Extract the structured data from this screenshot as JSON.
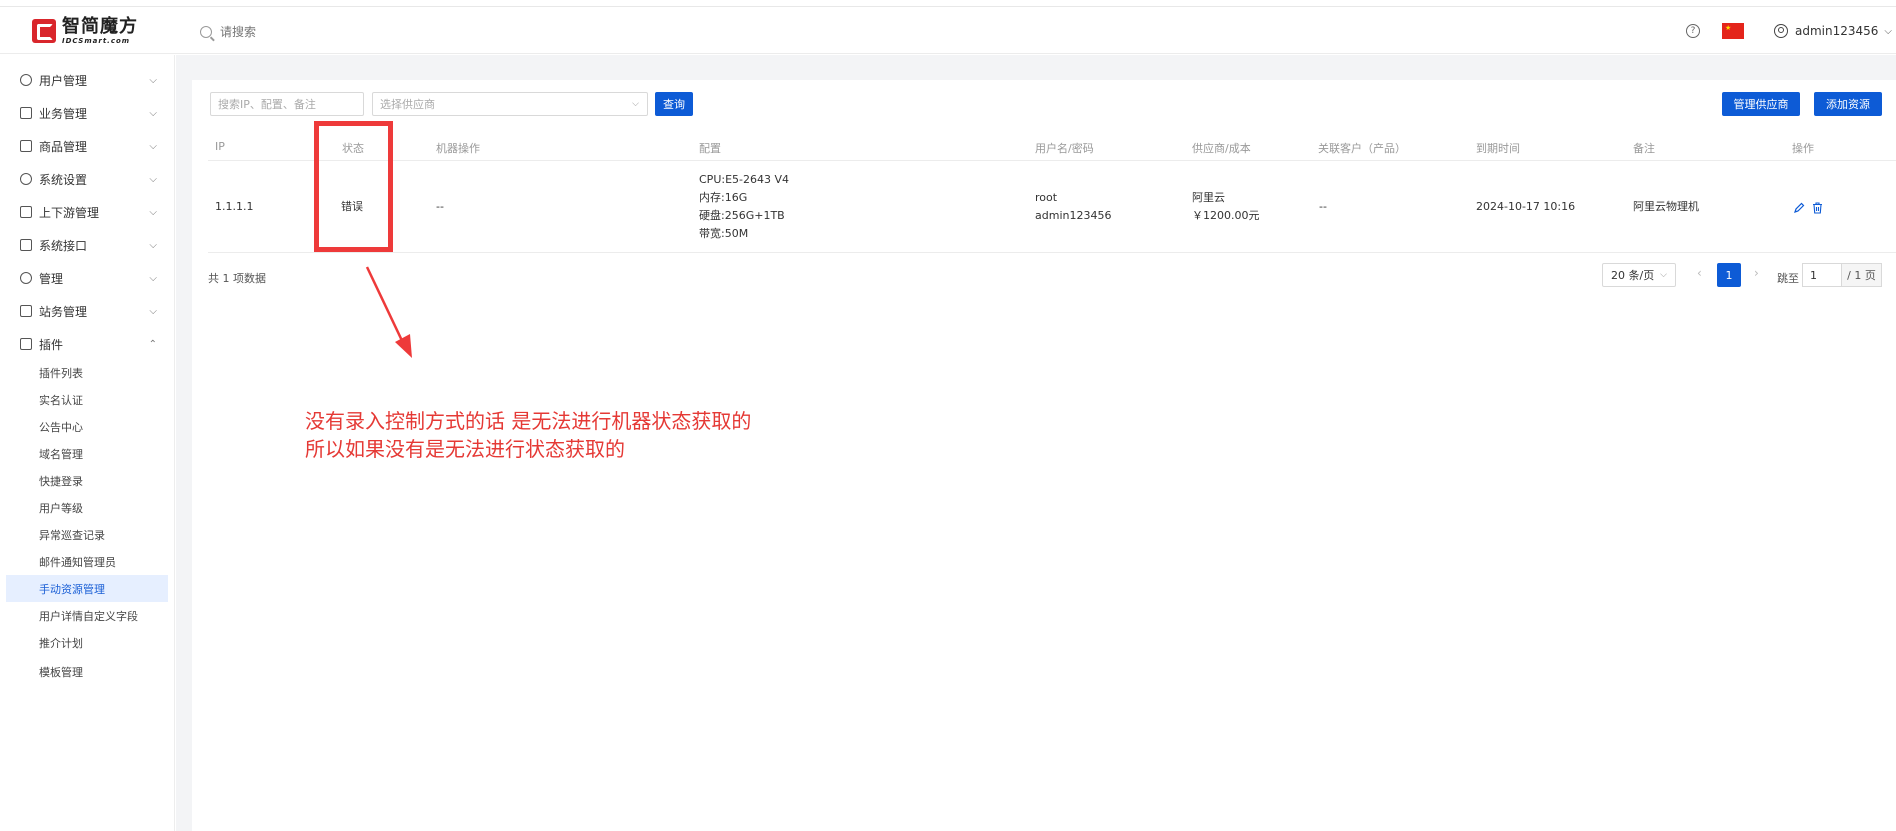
{
  "header": {
    "logo_cn": "智简魔方",
    "logo_en": "IDCSmart.com",
    "search_placeholder": "请搜索",
    "help": "?",
    "username": "admin123456"
  },
  "sidebar": {
    "items": [
      {
        "label": "用户管理"
      },
      {
        "label": "业务管理"
      },
      {
        "label": "商品管理"
      },
      {
        "label": "系统设置"
      },
      {
        "label": "上下游管理"
      },
      {
        "label": "系统接口"
      },
      {
        "label": "管理"
      },
      {
        "label": "站务管理"
      },
      {
        "label": "插件"
      }
    ],
    "sub_items": [
      {
        "label": "插件列表"
      },
      {
        "label": "实名认证"
      },
      {
        "label": "公告中心"
      },
      {
        "label": "域名管理"
      },
      {
        "label": "快捷登录"
      },
      {
        "label": "用户等级"
      },
      {
        "label": "异常巡查记录"
      },
      {
        "label": "邮件通知管理员"
      },
      {
        "label": "手动资源管理"
      },
      {
        "label": "用户详情自定义字段"
      },
      {
        "label": "推介计划"
      },
      {
        "label": "模板管理"
      }
    ]
  },
  "toolbar": {
    "search_placeholder": "搜索IP、配置、备注",
    "supplier_placeholder": "选择供应商",
    "query_label": "查询",
    "manage_supplier_label": "管理供应商",
    "add_resource_label": "添加资源"
  },
  "table": {
    "columns": [
      "IP",
      "状态",
      "机器操作",
      "配置",
      "用户名/密码",
      "供应商/成本",
      "关联客户（产品）",
      "到期时间",
      "备注",
      "操作"
    ],
    "rows": [
      {
        "ip": "1.1.1.1",
        "status": "错误",
        "machine_op": "--",
        "config": [
          "CPU:E5-2643 V4",
          "内存:16G",
          "硬盘:256G+1TB",
          "带宽:50M"
        ],
        "credentials": [
          "root",
          "admin123456"
        ],
        "supplier_cost": [
          "阿里云",
          "￥1200.00元"
        ],
        "client": "--",
        "expire": "2024-10-17 10:16",
        "note": "阿里云物理机"
      }
    ]
  },
  "pagination": {
    "total_text": "共 1 项数据",
    "page_size": "20 条/页",
    "current_page": "1",
    "jump_label": "跳至",
    "jump_value": "1",
    "total_pages": "/ 1 页"
  },
  "annotation": {
    "line1": "没有录入控制方式的话  是无法进行机器状态获取的",
    "line2": "所以如果没有是无法进行状态获取的",
    "color": "#e53935"
  },
  "colors": {
    "primary": "#0d5bd6",
    "flag": "#e4251b"
  }
}
